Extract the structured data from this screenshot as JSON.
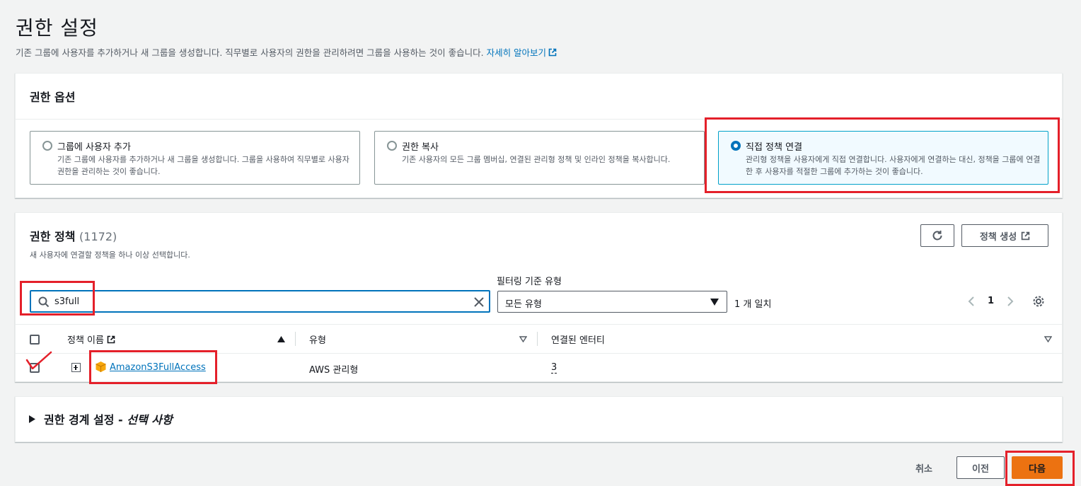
{
  "page": {
    "title": "권한 설정",
    "description": "기존 그룹에 사용자를 추가하거나 새 그룹을 생성합니다. 직무별로 사용자의 권한을 관리하려면 그룹을 사용하는 것이 좋습니다.",
    "learn_more": "자세히 알아보기"
  },
  "options": {
    "heading": "권한 옵션",
    "cards": [
      {
        "title": "그룹에 사용자 추가",
        "desc": "기존 그룹에 사용자를 추가하거나 새 그룹을 생성합니다. 그룹을 사용하여 직무별로 사용자 권한을 관리하는 것이 좋습니다.",
        "selected": false
      },
      {
        "title": "권한 복사",
        "desc": "기존 사용자의 모든 그룹 멤버십, 연결된 관리형 정책 및 인라인 정책을 복사합니다.",
        "selected": false
      },
      {
        "title": "직접 정책 연결",
        "desc": "관리형 정책을 사용자에게 직접 연결합니다. 사용자에게 연결하는 대신, 정책을 그룹에 연결한 후 사용자를 적절한 그룹에 추가하는 것이 좋습니다.",
        "selected": true
      }
    ]
  },
  "policies": {
    "heading": "권한 정책",
    "count": "(1172)",
    "subtitle": "새 사용자에 연결할 정책을 하나 이상 선택합니다.",
    "create_label": "정책 생성",
    "search_value": "s3full",
    "filter_label": "필터링 기준 유형",
    "filter_value": "모든 유형",
    "match_text": "1 개 일치",
    "page_number": "1",
    "columns": {
      "name": "정책 이름",
      "type": "유형",
      "entities": "연결된 엔터티"
    },
    "rows": [
      {
        "name": "AmazonS3FullAccess",
        "type": "AWS 관리형",
        "entities": "3",
        "checked": true
      }
    ]
  },
  "boundary": {
    "title": "권한 경계 설정 - ",
    "title_em": "선택 사항"
  },
  "footer": {
    "cancel": "취소",
    "prev": "이전",
    "next": "다음"
  },
  "colors": {
    "accent": "#0073bb",
    "primary_button": "#ec7211",
    "highlight": "#e4202a"
  }
}
